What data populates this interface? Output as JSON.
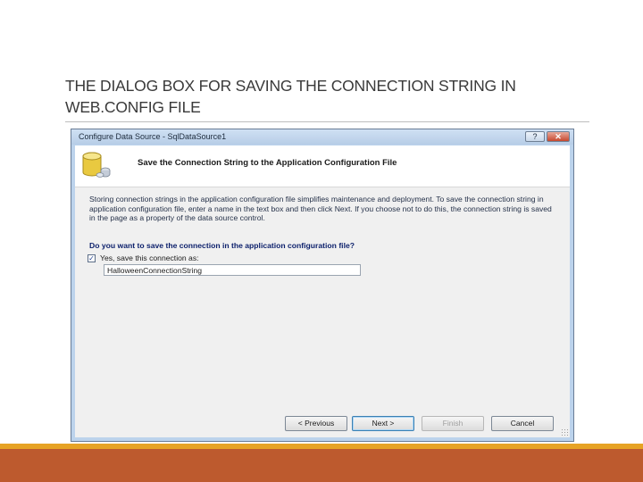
{
  "slide": {
    "title": "THE DIALOG BOX FOR SAVING THE CONNECTION STRING IN WEB.CONFIG FILE",
    "colors": {
      "stripe": "#e7a325",
      "bar": "#bd5a2e"
    }
  },
  "dialog": {
    "window_title": "Configure Data Source - SqlDataSource1",
    "help_glyph": "?",
    "close_glyph": "✕",
    "header_icon": "database-icon",
    "header_title": "Save the Connection String to the Application Configuration File",
    "description": "Storing connection strings in the application configuration file simplifies maintenance and deployment. To save the connection string in application configuration file, enter a name in the text box and then click Next. If you choose not to do this, the connection string is saved in the page as a property of the data source control.",
    "question": "Do you want to save the connection in the application configuration file?",
    "save_checkbox": {
      "checked": true,
      "glyph": "✓",
      "label": "Yes, save this connection as:"
    },
    "connection_name_value": "HalloweenConnectionString",
    "buttons": {
      "previous": "< Previous",
      "next": "Next >",
      "finish": "Finish",
      "cancel": "Cancel"
    }
  }
}
